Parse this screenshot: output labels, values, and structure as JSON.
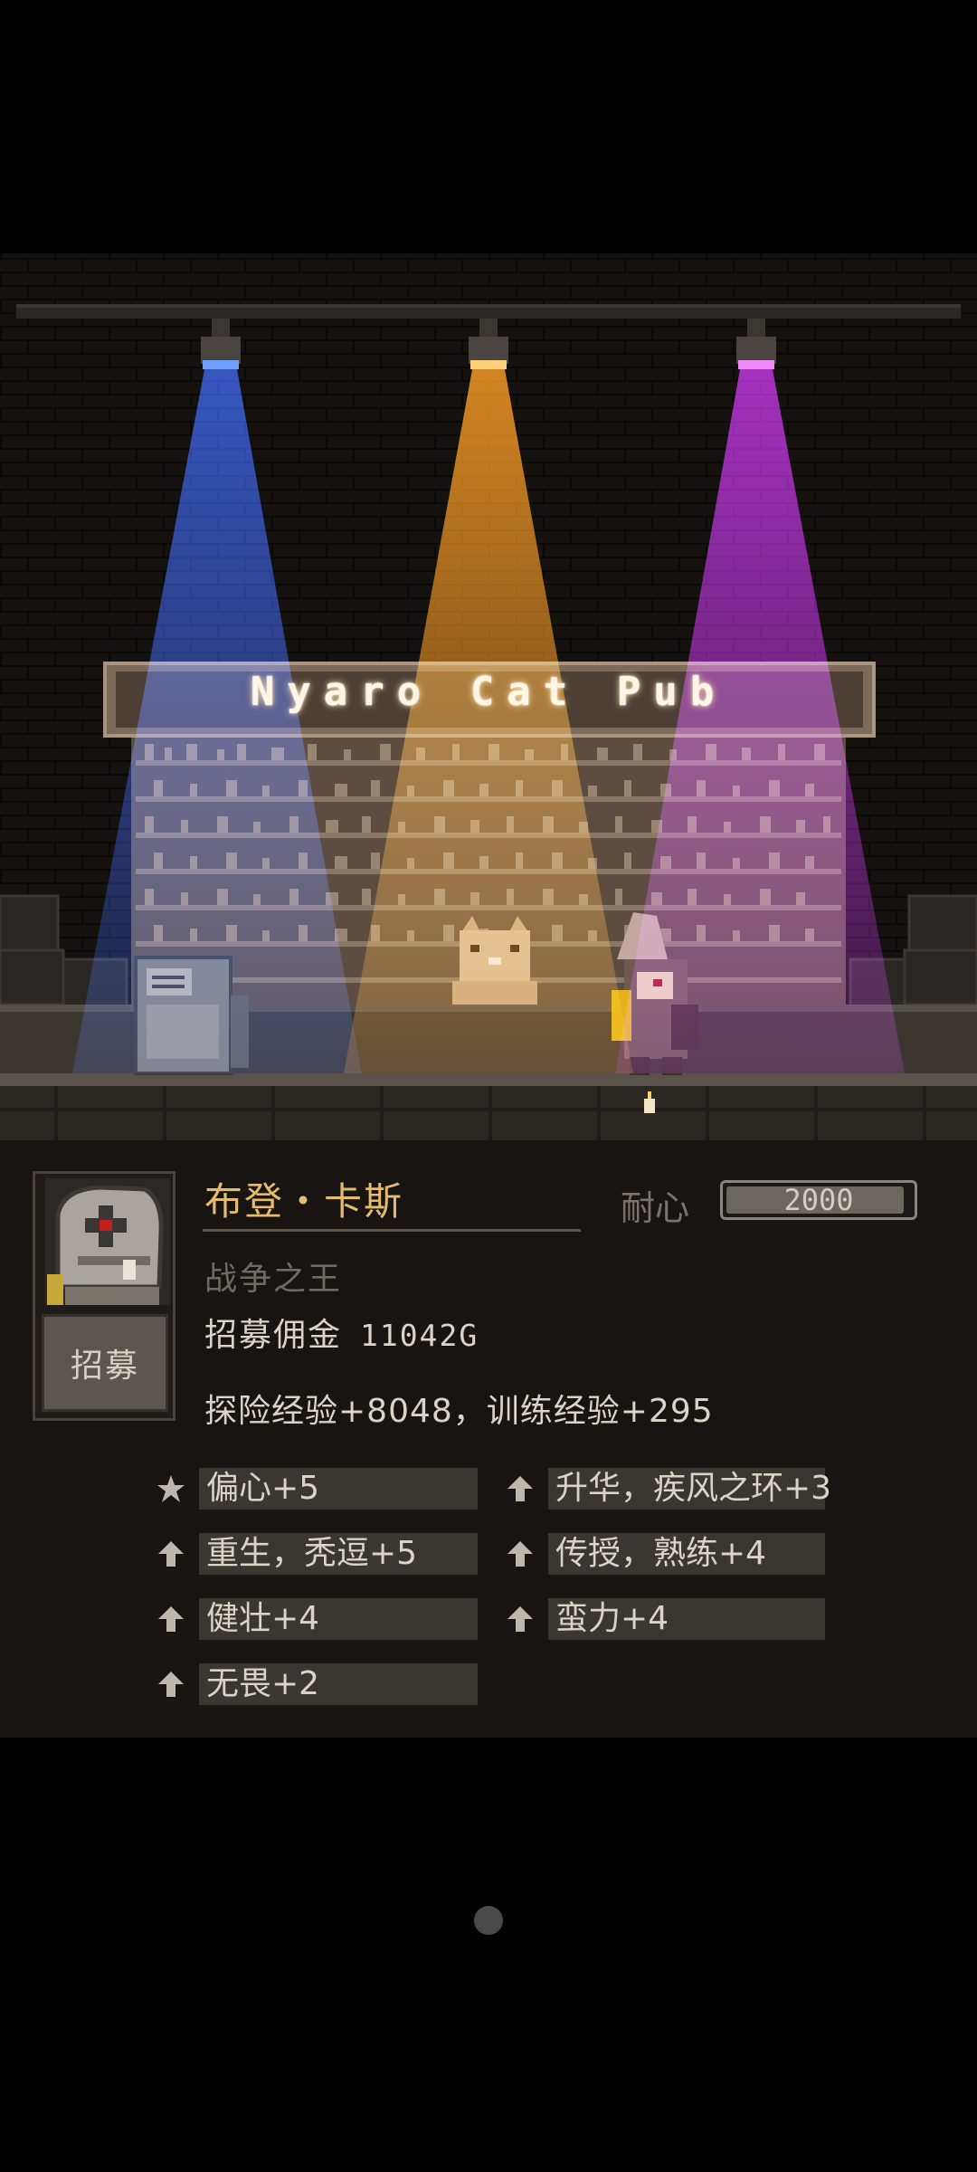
{
  "scene": {
    "sign_text": "Nyaro Cat Pub",
    "spotlight_colors": [
      "#2f5be6",
      "#ff9a1a",
      "#c12be6"
    ]
  },
  "character": {
    "name": "布登・卡斯",
    "title": "战争之王",
    "fee_label": "招募佣金",
    "fee_value": "11042G",
    "exp_text": "探险经验+8048，训练经验+295",
    "patience_label": "耐心",
    "patience_value": "2000",
    "patience_fraction": 0.96
  },
  "recruit_button": {
    "label": "招募"
  },
  "traits": [
    {
      "icon": "star-icon",
      "label": "偏心+5"
    },
    {
      "icon": "arrow-up-icon",
      "label": "升华，疾风之环+3"
    },
    {
      "icon": "arrow-up-icon",
      "label": "重生，秃逗+5"
    },
    {
      "icon": "arrow-up-icon",
      "label": "传授，熟练+4"
    },
    {
      "icon": "arrow-up-icon",
      "label": "健壮+4"
    },
    {
      "icon": "arrow-up-icon",
      "label": "蛮力+4"
    },
    {
      "icon": "arrow-up-icon",
      "label": "无畏+2"
    }
  ],
  "colors": {
    "name": "#e5bb6c",
    "panel": "#171412",
    "trait_bg": "#3a3631"
  }
}
